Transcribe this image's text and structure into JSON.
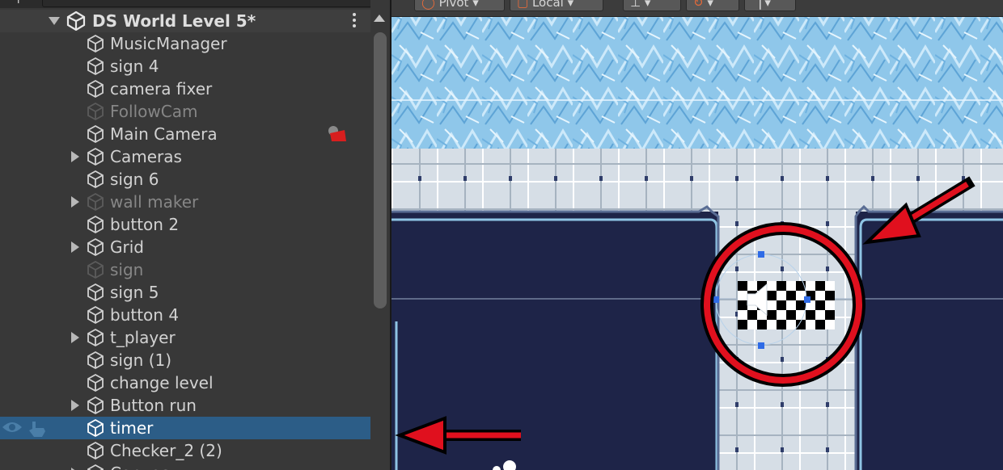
{
  "hierarchy": {
    "scene_name": "DS World Level 5*",
    "items": [
      {
        "label": "MusicManager",
        "has_children": false,
        "active": true
      },
      {
        "label": "sign 4",
        "has_children": false,
        "active": true
      },
      {
        "label": "camera fixer",
        "has_children": false,
        "active": true
      },
      {
        "label": "FollowCam",
        "has_children": false,
        "active": false
      },
      {
        "label": "Main Camera",
        "has_children": false,
        "active": true
      },
      {
        "label": "Cameras",
        "has_children": true,
        "active": true
      },
      {
        "label": "sign 6",
        "has_children": false,
        "active": true
      },
      {
        "label": "wall maker",
        "has_children": true,
        "active": false
      },
      {
        "label": "button 2",
        "has_children": false,
        "active": true
      },
      {
        "label": "Grid",
        "has_children": true,
        "active": true
      },
      {
        "label": "sign",
        "has_children": false,
        "active": false
      },
      {
        "label": "sign 5",
        "has_children": false,
        "active": true
      },
      {
        "label": "button 4",
        "has_children": false,
        "active": true
      },
      {
        "label": "t_player",
        "has_children": true,
        "active": true
      },
      {
        "label": "sign (1)",
        "has_children": false,
        "active": true
      },
      {
        "label": "change level",
        "has_children": false,
        "active": true
      },
      {
        "label": "Button run",
        "has_children": true,
        "active": true
      },
      {
        "label": "timer",
        "has_children": false,
        "active": true,
        "selected": true
      },
      {
        "label": "Checker_2 (2)",
        "has_children": false,
        "active": true
      },
      {
        "label": "Canvas",
        "has_children": true,
        "active": true
      }
    ]
  },
  "toolbar": {
    "pivot_label": "Pivot",
    "local_label": "Local"
  },
  "icons": {
    "scene": "unity-logo-icon",
    "object": "gameobject-cube-icon",
    "camera_gizmo": "camera-gizmo-icon",
    "visibility": "eye-icon",
    "pickable": "hand-pointer-icon",
    "menu": "kebab-menu-icon",
    "sound": "speaker-icon"
  },
  "colors": {
    "selection": "#2c5d87",
    "annotation": "#e0101e",
    "scene_background": "#1e2448"
  }
}
